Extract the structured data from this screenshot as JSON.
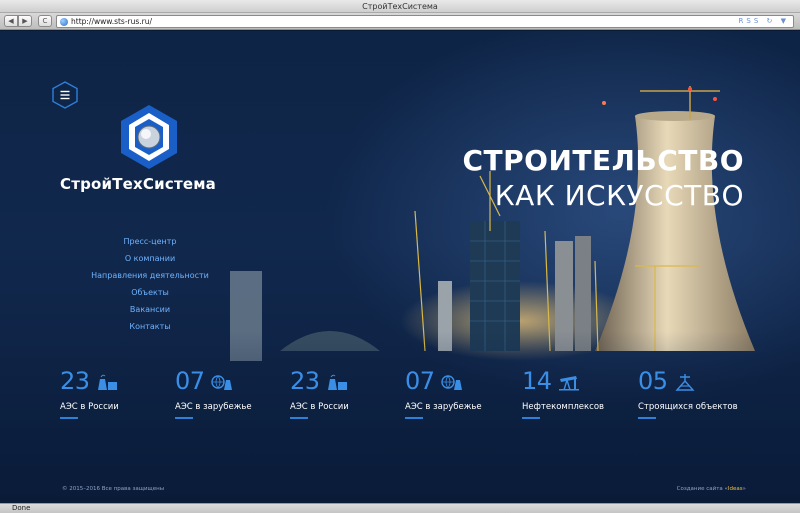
{
  "window": {
    "title": "СтройТехСистема"
  },
  "toolbar": {
    "back": "◀",
    "forward": "▶",
    "reload": "C",
    "url": "http://www.sts-rus.ru/",
    "right_icons": "RSS ↻ ▼"
  },
  "brand": {
    "logo_text": "СтройТехСистема"
  },
  "nav": {
    "items": [
      "Пресс-центр",
      "О компании",
      "Направления деятельности",
      "Объекты",
      "Вакансии",
      "Контакты"
    ]
  },
  "hero": {
    "line1": "СТРОИТЕЛЬСТВО",
    "line2": "КАК ИСКУССТВО"
  },
  "stats": [
    {
      "number": "23",
      "label": "АЭС в России",
      "icon": "nuclear-plant-icon"
    },
    {
      "number": "07",
      "label": "АЭС в зарубежье",
      "icon": "globe-plant-icon"
    },
    {
      "number": "23",
      "label": "АЭС в России",
      "icon": "nuclear-plant-icon"
    },
    {
      "number": "07",
      "label": "АЭС в зарубежье",
      "icon": "globe-plant-icon"
    },
    {
      "number": "14",
      "label": "Нефтекомплексов",
      "icon": "oil-pump-icon"
    },
    {
      "number": "05",
      "label": "Строящихся объектов",
      "icon": "construction-icon"
    }
  ],
  "footer": {
    "copyright": "© 2015–2016 Все права защищены",
    "credit_prefix": "Создание сайта «",
    "credit_link": "Ideas",
    "credit_suffix": "»"
  },
  "status": {
    "text": "Done"
  },
  "colors": {
    "accent": "#3b8ee6",
    "nav_link": "#6fb3ff",
    "background": "#0e2446"
  }
}
